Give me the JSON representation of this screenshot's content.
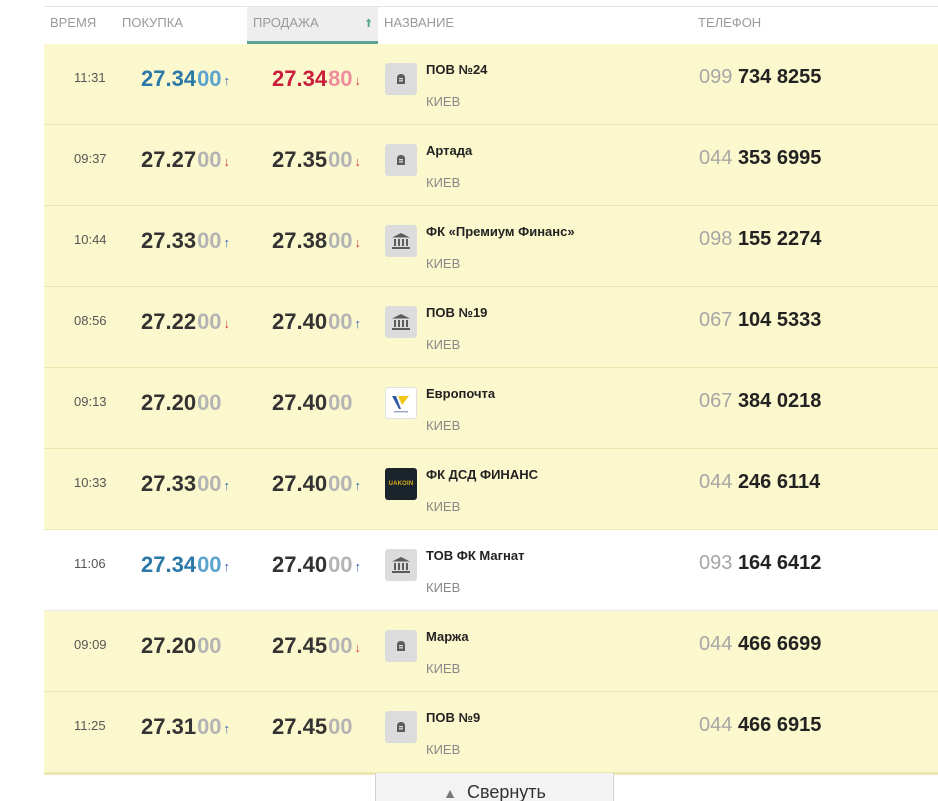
{
  "header": {
    "time": "ВРЕМЯ",
    "buy": "ПОКУПКА",
    "sell": "ПРОДАЖА",
    "sell_sort_icon": "arrow-up-icon",
    "name": "НАЗВАНИЕ",
    "phone": "ТЕЛЕФОН"
  },
  "colors": {
    "row_highlight": "#fcf8cd",
    "sort_accent": "#5aa593",
    "best_buy": "#2a78a8",
    "best_sell": "#c91d3b",
    "arrow_up": "#3563b5",
    "arrow_down": "#d93c3c"
  },
  "rows": [
    {
      "time": "11:31",
      "buy": "27.34",
      "buy_cents": "00",
      "buy_dir": "up",
      "sell": "27.34",
      "sell_cents": "80",
      "sell_dir": "down",
      "logo": "small-bank-icon",
      "name": "ПОВ №24",
      "city": "КИЕВ",
      "phone_code": "099",
      "phone_num": "734 8255",
      "buy_hl": "blue",
      "sell_hl": "red",
      "bg": "yellow"
    },
    {
      "time": "09:37",
      "buy": "27.27",
      "buy_cents": "00",
      "buy_dir": "down",
      "sell": "27.35",
      "sell_cents": "00",
      "sell_dir": "down",
      "logo": "small-bank-icon",
      "name": "Артада",
      "city": "КИЕВ",
      "phone_code": "044",
      "phone_num": "353 6995",
      "buy_hl": "",
      "sell_hl": "",
      "bg": "yellow"
    },
    {
      "time": "10:44",
      "buy": "27.33",
      "buy_cents": "00",
      "buy_dir": "up",
      "sell": "27.38",
      "sell_cents": "00",
      "sell_dir": "down",
      "logo": "bank-building-icon",
      "name": "ФК «Премиум Финанс»",
      "city": "КИЕВ",
      "phone_code": "098",
      "phone_num": "155 2274",
      "buy_hl": "",
      "sell_hl": "",
      "bg": "yellow"
    },
    {
      "time": "08:56",
      "buy": "27.22",
      "buy_cents": "00",
      "buy_dir": "down",
      "sell": "27.40",
      "sell_cents": "00",
      "sell_dir": "up",
      "logo": "bank-building-icon",
      "name": "ПОВ №19",
      "city": "КИЕВ",
      "phone_code": "067",
      "phone_num": "104 5333",
      "buy_hl": "",
      "sell_hl": "",
      "bg": "yellow"
    },
    {
      "time": "09:13",
      "buy": "27.20",
      "buy_cents": "00",
      "buy_dir": "",
      "sell": "27.40",
      "sell_cents": "00",
      "sell_dir": "",
      "logo": "europochta-logo-icon",
      "name": "Европочта",
      "city": "КИЕВ",
      "phone_code": "067",
      "phone_num": "384 0218",
      "buy_hl": "",
      "sell_hl": "",
      "bg": "yellow"
    },
    {
      "time": "10:33",
      "buy": "27.33",
      "buy_cents": "00",
      "buy_dir": "up",
      "sell": "27.40",
      "sell_cents": "00",
      "sell_dir": "up",
      "logo": "dsd-logo-icon",
      "logo_text": "UAKOIN",
      "name": "ФК ДСД ФИНАНС",
      "city": "КИЕВ",
      "phone_code": "044",
      "phone_num": "246 6114",
      "buy_hl": "",
      "sell_hl": "",
      "bg": "yellow"
    },
    {
      "time": "11:06",
      "buy": "27.34",
      "buy_cents": "00",
      "buy_dir": "up",
      "sell": "27.40",
      "sell_cents": "00",
      "sell_dir": "up",
      "logo": "bank-building-icon",
      "name": "ТОВ ФК Магнат",
      "city": "КИЕВ",
      "phone_code": "093",
      "phone_num": "164 6412",
      "buy_hl": "blue",
      "sell_hl": "",
      "bg": "white"
    },
    {
      "time": "09:09",
      "buy": "27.20",
      "buy_cents": "00",
      "buy_dir": "",
      "sell": "27.45",
      "sell_cents": "00",
      "sell_dir": "down",
      "logo": "small-bank-icon",
      "name": "Маржа",
      "city": "КИЕВ",
      "phone_code": "044",
      "phone_num": "466 6699",
      "buy_hl": "",
      "sell_hl": "",
      "bg": "yellow"
    },
    {
      "time": "11:25",
      "buy": "27.31",
      "buy_cents": "00",
      "buy_dir": "up",
      "sell": "27.45",
      "sell_cents": "00",
      "sell_dir": "",
      "logo": "small-bank-icon",
      "name": "ПОВ №9",
      "city": "КИЕВ",
      "phone_code": "044",
      "phone_num": "466 6915",
      "buy_hl": "",
      "sell_hl": "",
      "bg": "yellow"
    }
  ],
  "collapse_button": {
    "label": "Свернуть",
    "icon": "triangle-up-icon"
  }
}
